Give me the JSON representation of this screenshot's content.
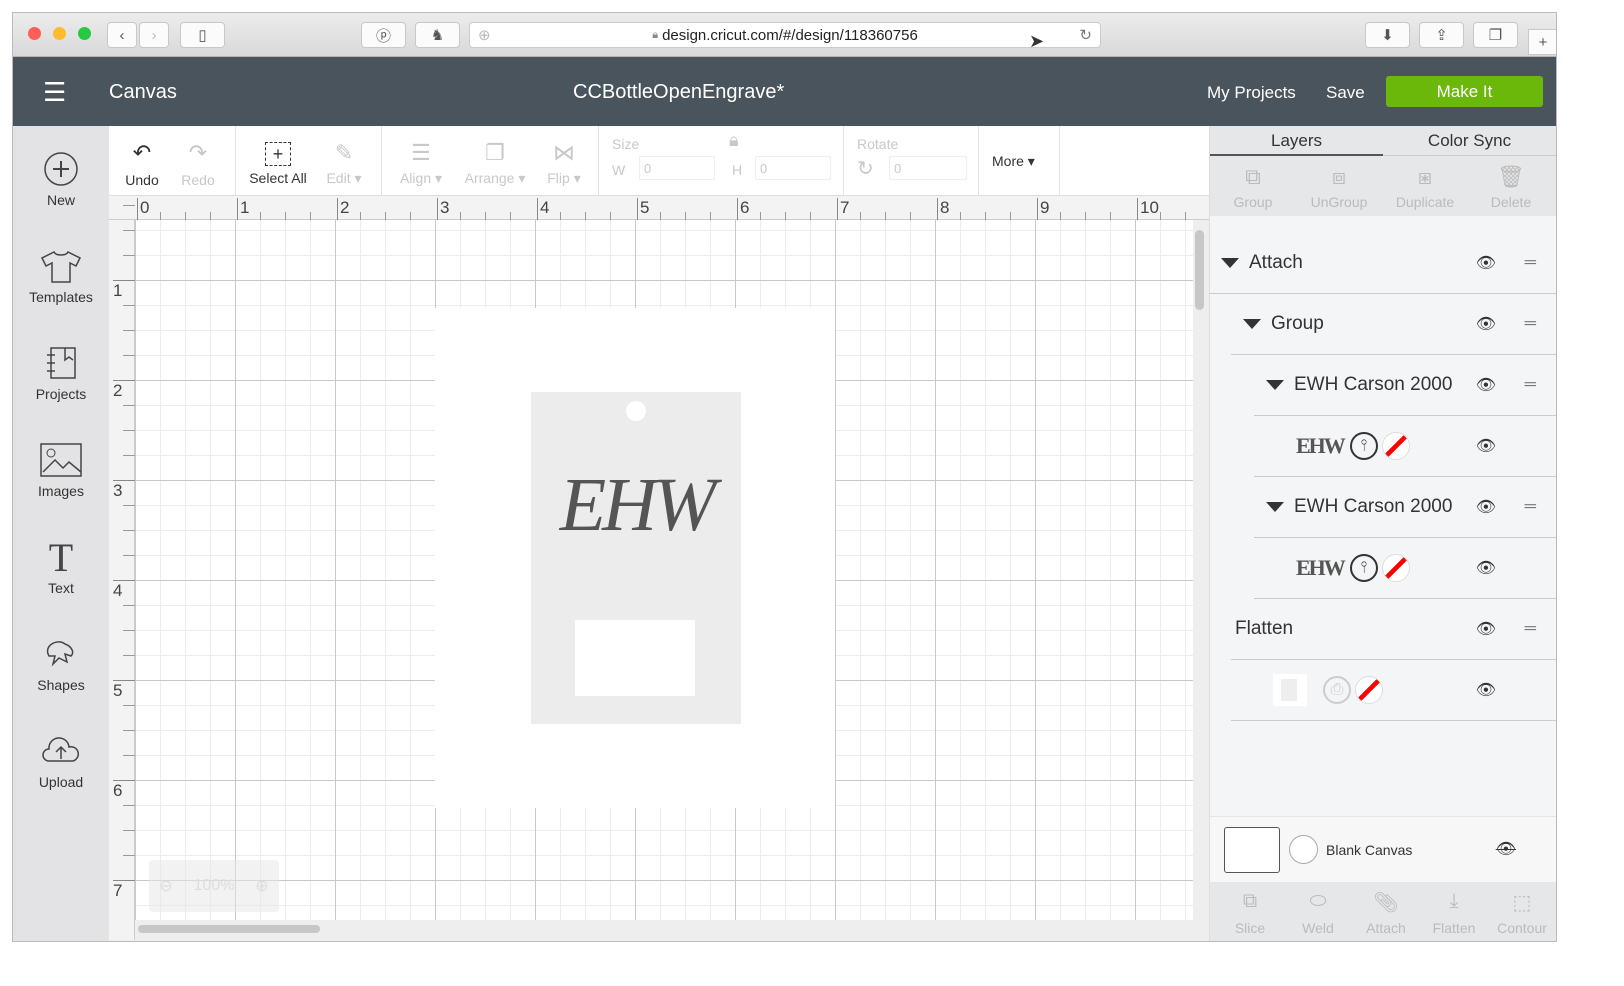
{
  "browser": {
    "url": "design.cricut.com/#/design/118360756",
    "new_tab": "+"
  },
  "header": {
    "section": "Canvas",
    "project_title": "CCBottleOpenEngrave*",
    "my_projects": "My Projects",
    "save": "Save",
    "make_it": "Make It"
  },
  "sidebar": {
    "items": [
      {
        "label": "New"
      },
      {
        "label": "Templates"
      },
      {
        "label": "Projects"
      },
      {
        "label": "Images"
      },
      {
        "label": "Text"
      },
      {
        "label": "Shapes"
      },
      {
        "label": "Upload"
      }
    ]
  },
  "toolbar": {
    "undo": "Undo",
    "redo": "Redo",
    "select_all": "Select All",
    "edit": "Edit",
    "align": "Align",
    "arrange": "Arrange",
    "flip": "Flip",
    "size": "Size",
    "w": "W",
    "h": "H",
    "w_value": "0",
    "h_value": "0",
    "rotate": "Rotate",
    "rotate_value": "0",
    "more": "More"
  },
  "ruler": {
    "h": [
      "0",
      "1",
      "2",
      "3",
      "4",
      "5",
      "6",
      "7",
      "8",
      "9",
      "10"
    ],
    "v": [
      "1",
      "2",
      "3",
      "4",
      "5",
      "6",
      "7"
    ]
  },
  "canvas": {
    "monogram": "EHW",
    "zoom": "100%"
  },
  "panel": {
    "tabs": [
      "Layers",
      "Color Sync"
    ],
    "tools": [
      "Group",
      "UnGroup",
      "Duplicate",
      "Delete"
    ],
    "layers": [
      {
        "label": "Attach"
      },
      {
        "label": "Group"
      },
      {
        "label": "EWH Carson 2000"
      },
      {
        "label": "EHW"
      },
      {
        "label": "EWH Carson 2000"
      },
      {
        "label": "EHW"
      },
      {
        "label": "Flatten"
      }
    ],
    "blank_canvas": "Blank Canvas",
    "bottom_tools": [
      "Slice",
      "Weld",
      "Attach",
      "Flatten",
      "Contour"
    ]
  }
}
